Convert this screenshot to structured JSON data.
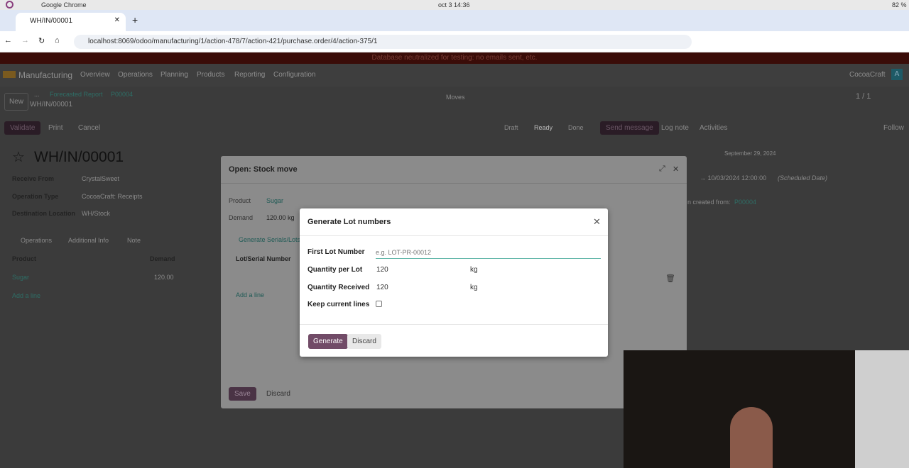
{
  "os": {
    "app": "Google Chrome",
    "clock": "oct 3  14:36",
    "battery": "82 %"
  },
  "browser": {
    "tab_title": "WH/IN/00001",
    "url": "localhost:8069/odoo/manufacturing/1/action-478/7/action-421/purchase.order/4/action-375/1"
  },
  "banner": "Database neutralized for testing: no emails sent, etc.",
  "nav": {
    "app": "Manufacturing",
    "items": [
      "Overview",
      "Operations",
      "Planning",
      "Products",
      "Reporting",
      "Configuration"
    ],
    "company": "CocoaCraft",
    "avatar": "A",
    "pager": "1 / 1"
  },
  "control": {
    "new": "New",
    "breadcrumb": [
      "...",
      "Forecasted Report",
      "P00004"
    ],
    "record": "WH/IN/00001",
    "moves": "Moves"
  },
  "actions": {
    "validate": "Validate",
    "print": "Print",
    "cancel": "Cancel",
    "states": [
      "Draft",
      "Ready",
      "Done"
    ],
    "active_state": "Ready"
  },
  "chatter": {
    "send": "Send message",
    "log": "Log note",
    "activities": "Activities",
    "follow": "Follow",
    "date": "September 29, 2024",
    "change": "→ 10/03/2024 12:00:00",
    "change_label": "(Scheduled Date)",
    "created": "n created from:",
    "created_link": "P00004"
  },
  "form": {
    "title": "WH/IN/00001",
    "fields": [
      {
        "label": "Receive From",
        "value": "CrystalSweet"
      },
      {
        "label": "Operation Type",
        "value": "CocoaCraft: Receipts"
      },
      {
        "label": "Destination Location",
        "value": "WH/Stock"
      }
    ],
    "tabs": [
      "Operations",
      "Additional Info",
      "Note"
    ],
    "columns": [
      "Product",
      "Demand"
    ],
    "rows": [
      {
        "product": "Sugar",
        "demand": "120.00"
      }
    ],
    "add_line": "Add a line"
  },
  "stock_move": {
    "title": "Open: Stock move",
    "product_label": "Product",
    "product": "Sugar",
    "demand_label": "Demand",
    "demand_help": "?",
    "demand": "120.00 kg",
    "generate": "Generate Serials/Lots",
    "lot_col": "Lot/Serial Number",
    "add_line": "Add a line",
    "save": "Save",
    "discard": "Discard"
  },
  "lot_dialog": {
    "title": "Generate Lot numbers",
    "first_label": "First Lot Number",
    "first_placeholder": "e.g. LOT-PR-00012",
    "qty_lot_label": "Quantity per Lot",
    "qty_lot": "120",
    "qty_recv_label": "Quantity Received",
    "qty_recv": "120",
    "unit": "kg",
    "keep_label": "Keep current lines",
    "keep_checked": false,
    "generate": "Generate",
    "discard": "Discard"
  },
  "colors": {
    "primary": "#714b67",
    "link": "#017e84"
  }
}
